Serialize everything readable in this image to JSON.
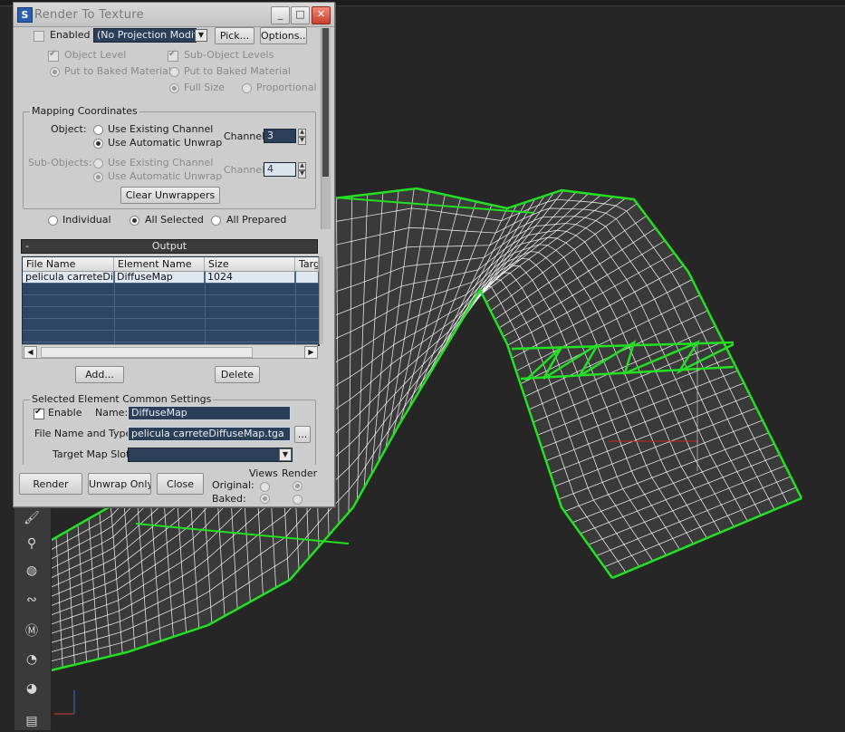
{
  "dialog": {
    "title": "Render To Texture",
    "win_buttons": {
      "minimize": "_",
      "maximize": "□",
      "close": "✕"
    }
  },
  "projection": {
    "enabled_label": "Enabled",
    "modifier_value": "(No Projection Modifier)",
    "pick_label": "Pick...",
    "options_label": "Options...",
    "object_level_label": "Object Level",
    "sub_object_levels_label": "Sub-Object Levels",
    "put_to_baked_material_left": "Put to Baked Material",
    "put_to_baked_material_right": "Put to Baked Material",
    "full_size_label": "Full Size",
    "proportional_label": "Proportional"
  },
  "mapping": {
    "group_title": "Mapping Coordinates",
    "object_label": "Object:",
    "use_existing_channel": "Use Existing Channel",
    "use_automatic_unwrap": "Use Automatic Unwrap",
    "channel_label": "Channel:",
    "channel_value": "3",
    "sub_objects_label": "Sub-Objects:",
    "sub_use_existing_channel": "Use Existing Channel",
    "sub_use_automatic_unwrap": "Use Automatic Unwrap",
    "sub_channel_label": "Channel:",
    "sub_channel_value": "4",
    "clear_unwrappers_label": "Clear Unwrappers"
  },
  "selection": {
    "individual": "Individual",
    "all_selected": "All Selected",
    "all_prepared": "All Prepared"
  },
  "output": {
    "rollout_minus": "-",
    "rollout_title": "Output",
    "columns": [
      "File Name",
      "Element Name",
      "Size",
      "Targ"
    ],
    "rows": [
      [
        "pelicula carreteDif...",
        "DiffuseMap",
        "1024",
        ""
      ]
    ],
    "add_label": "Add...",
    "delete_label": "Delete"
  },
  "element_settings": {
    "group_title": "Selected Element Common Settings",
    "enable_label": "Enable",
    "name_label": "Name:",
    "name_value": "DiffuseMap",
    "file_label": "File Name and Type:",
    "file_value": "pelicula carreteDiffuseMap.tga",
    "browse_label": "...",
    "target_slot_label": "Target Map Slot:",
    "target_slot_value": ""
  },
  "bottom": {
    "render_label": "Render",
    "unwrap_only_label": "Unwrap Only",
    "close_label": "Close",
    "views_label": "Views",
    "render_col_label": "Render",
    "original_label": "Original:",
    "baked_label": "Baked:"
  },
  "toolstrip": {
    "icons": [
      "paint-icon",
      "bone-icon",
      "sphere-icon",
      "wave-icon",
      "material-icon",
      "map-icon",
      "map-alt-icon",
      "list-icon"
    ]
  },
  "colors": {
    "wireframe": "#ffffff",
    "selection_edge": "#22e022",
    "viewport_bg": "#262626",
    "field_bg": "#2b3f58"
  }
}
